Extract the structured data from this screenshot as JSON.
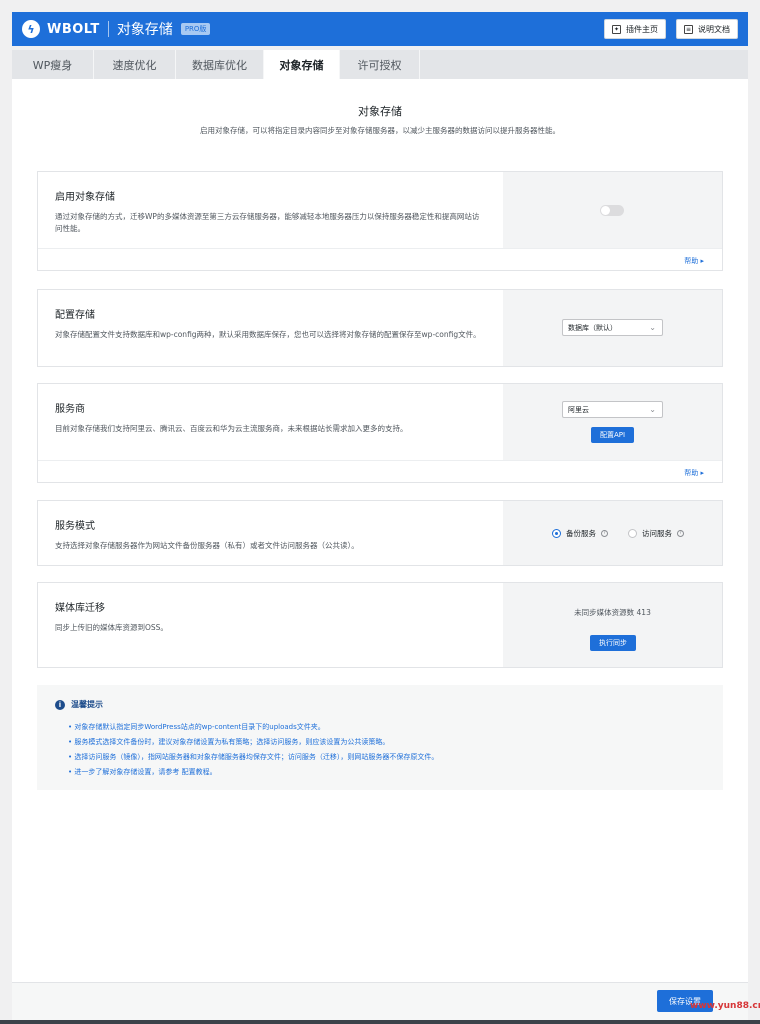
{
  "header": {
    "brand": "WBOLT",
    "product": "对象存储",
    "badge": "PRO版",
    "buttons": [
      {
        "label": "插件主页",
        "icon": "puzzle-icon"
      },
      {
        "label": "说明文档",
        "icon": "document-icon"
      }
    ]
  },
  "tabs": [
    {
      "label": "WP瘦身",
      "active": false
    },
    {
      "label": "速度优化",
      "active": false
    },
    {
      "label": "数据库优化",
      "active": false
    },
    {
      "label": "对象存储",
      "active": true
    },
    {
      "label": "许可授权",
      "active": false
    }
  ],
  "page": {
    "title": "对象存储",
    "description": "启用对象存储，可以将指定目录内容同步至对象存储服务器，以减少主服务器的数据访问以提升服务器性能。"
  },
  "sections": {
    "enable": {
      "title": "启用对象存储",
      "description": "通过对象存储的方式，迁移WP的多媒体资源至第三方云存储服务器，能够减轻本地服务器压力以保持服务器稳定性和提高网站访问性能。",
      "enabled": false,
      "help": "帮助 ▸"
    },
    "config": {
      "title": "配置存储",
      "description": "对象存储配置文件支持数据库和wp-config两种，默认采用数据库保存，您也可以选择将对象存储的配置保存至wp-config文件。",
      "selected": "数据库（默认）"
    },
    "provider": {
      "title": "服务商",
      "description": "目前对象存储我们支持阿里云、腾讯云、百度云和华为云主流服务商，未来根据站长需求加入更多的支持。",
      "selected": "阿里云",
      "config_button": "配置API",
      "help": "帮助 ▸"
    },
    "mode": {
      "title": "服务模式",
      "description": "支持选择对象存储服务器作为网站文件备份服务器（私有）或者文件访问服务器（公共读）。",
      "options": [
        {
          "label": "备份服务",
          "selected": true
        },
        {
          "label": "访问服务",
          "selected": false
        }
      ]
    },
    "migrate": {
      "title": "媒体库迁移",
      "description": "同步上传旧的媒体库资源到OSS。",
      "status": "未同步媒体资源数 413",
      "sync_button": "执行同步"
    }
  },
  "tips": {
    "title": "温馨提示",
    "items": [
      "对象存储默认指定同步WordPress站点的wp-content目录下的uploads文件夹。",
      "服务模式选择文件备份时，建议对象存储设置为私有策略；选择访问服务，则应该设置为公共读策略。",
      "选择访问服务（镜像），指网站服务器和对象存储服务器均保存文件；访问服务（迁移），则网站服务器不保存原文件。",
      "进一步了解对象存储设置，请参考 配置教程。"
    ]
  },
  "footer": {
    "save_label": "保存设置",
    "watermark": "www.yun88.cn"
  },
  "colors": {
    "brand": "#1e6fd9",
    "panel_bg": "#f3f4f5"
  }
}
